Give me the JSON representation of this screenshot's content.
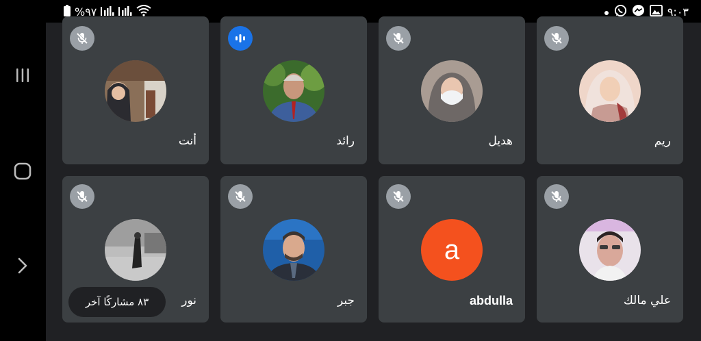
{
  "status_bar": {
    "battery": "%٩٧",
    "time": "٩:٠٣",
    "icons": [
      "battery-icon",
      "signal-icon",
      "signal-icon",
      "wifi-icon",
      "dot-icon",
      "whatsapp-icon",
      "messenger-icon",
      "gallery-icon"
    ]
  },
  "nav_bar": {
    "icons": [
      "recents-icon",
      "home-icon",
      "back-icon"
    ]
  },
  "participants": [
    {
      "name": "أنت",
      "mic": "muted"
    },
    {
      "name": "رائد",
      "mic": "speaking"
    },
    {
      "name": "هديل",
      "mic": "muted"
    },
    {
      "name": "ريم",
      "mic": "muted"
    },
    {
      "name": "نور",
      "mic": "muted"
    },
    {
      "name": "جبر",
      "mic": "muted"
    },
    {
      "name": "abdulla",
      "mic": "muted",
      "avatar_letter": "a",
      "avatar_color": "#f4511e"
    },
    {
      "name": "علي مالك",
      "mic": "muted"
    }
  ],
  "others_label": "٨٣ مشاركًا آخر",
  "colors": {
    "tile": "#3c4043",
    "background": "#202124",
    "speaking": "#1a73e8",
    "muted_badge": "#9aa0a6"
  }
}
